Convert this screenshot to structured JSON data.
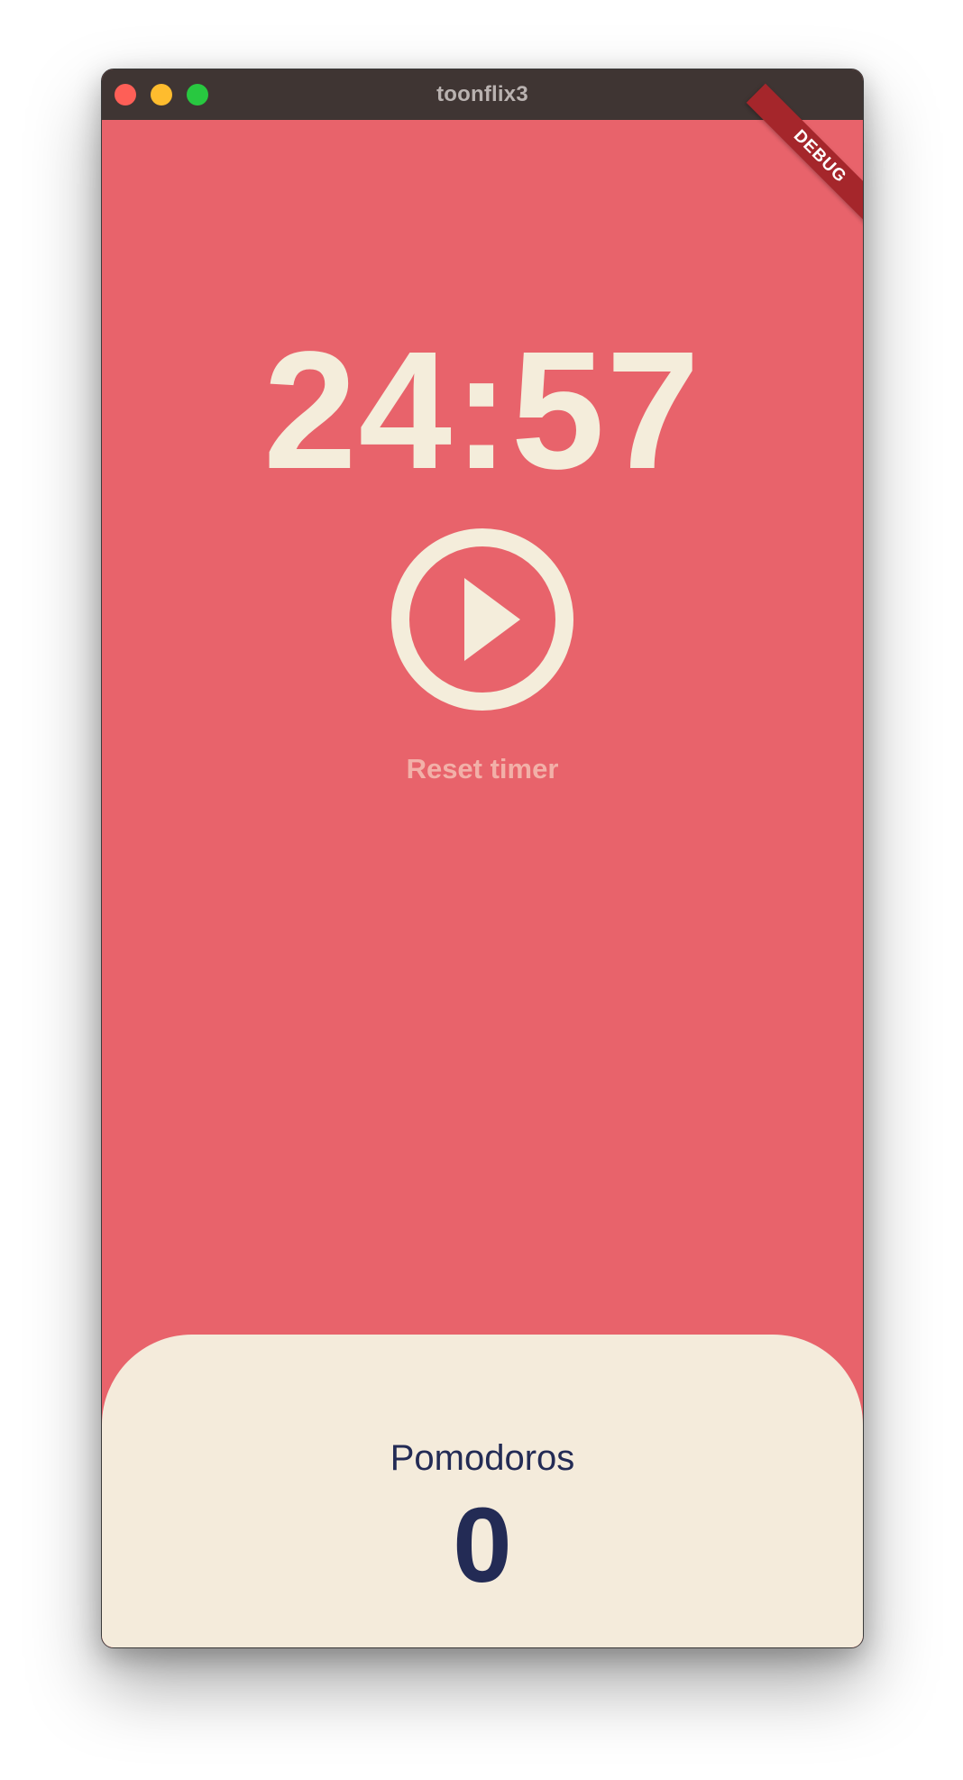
{
  "window": {
    "title": "toonflix3",
    "debug_banner": "DEBUG"
  },
  "timer": {
    "display": "24:57",
    "play_icon": "play-circle-icon",
    "reset_label": "Reset timer"
  },
  "pomodoros": {
    "label": "Pomodoros",
    "count": "0"
  },
  "colors": {
    "background": "#E8636B",
    "card": "#F4EBDB",
    "timer_text": "#F4EDDB",
    "card_text": "#232B55",
    "titlebar": "#3F3533"
  }
}
